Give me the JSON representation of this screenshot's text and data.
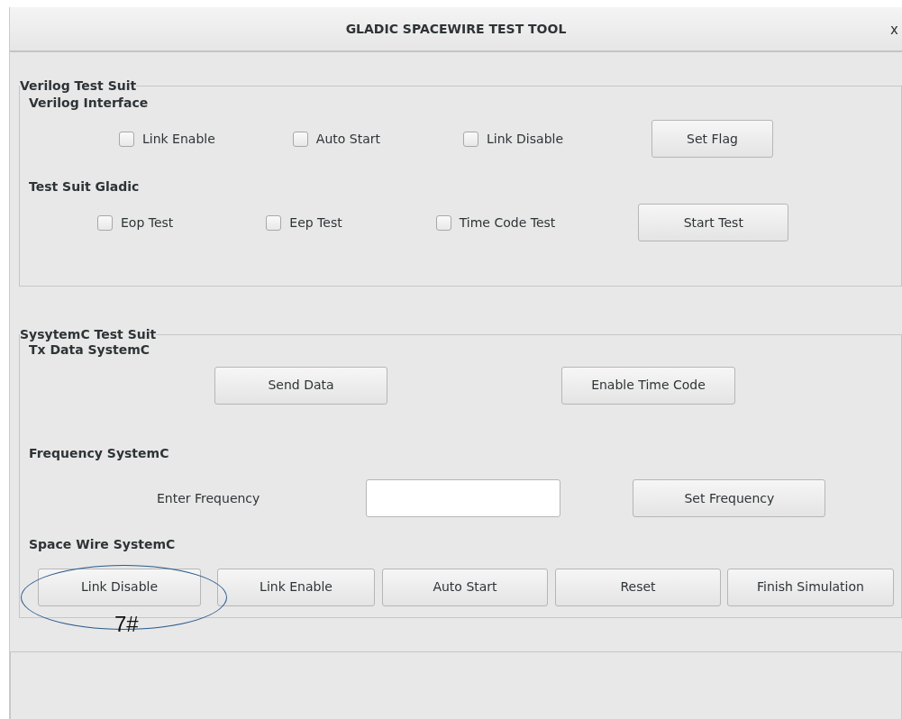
{
  "window": {
    "title": "GLADIC SPACEWIRE TEST TOOL",
    "close": "x"
  },
  "groups": [
    {
      "title": "Verilog Test Suit",
      "sections": [
        {
          "title": "Verilog Interface",
          "controls": [
            {
              "kind": "checkbox",
              "label": "Link Enable",
              "checked": false
            },
            {
              "kind": "checkbox",
              "label": "Auto Start",
              "checked": false
            },
            {
              "kind": "checkbox",
              "label": "Link Disable",
              "checked": false
            },
            {
              "kind": "button",
              "label": "Set Flag"
            }
          ]
        },
        {
          "title": "Test Suit Gladic",
          "controls": [
            {
              "kind": "checkbox",
              "label": "Eop Test",
              "checked": false
            },
            {
              "kind": "checkbox",
              "label": "Eep Test",
              "checked": false
            },
            {
              "kind": "checkbox",
              "label": "Time Code Test",
              "checked": false
            },
            {
              "kind": "button",
              "label": "Start Test"
            }
          ]
        }
      ]
    },
    {
      "title": "SysytemC Test Suit",
      "sections": [
        {
          "title": "Tx Data SystemC",
          "controls": [
            {
              "kind": "button",
              "label": "Send Data"
            },
            {
              "kind": "button",
              "label": "Enable Time Code"
            }
          ]
        },
        {
          "title": "Frequency  SystemC",
          "controls": [
            {
              "kind": "label",
              "label": "Enter Frequency"
            },
            {
              "kind": "field"
            },
            {
              "kind": "button",
              "label": "Set Frequency"
            }
          ]
        },
        {
          "title": "Space Wire SystemC",
          "controls": [
            {
              "kind": "button",
              "label": "Link Disable"
            },
            {
              "kind": "button",
              "label": "Link Enable"
            },
            {
              "kind": "button",
              "label": "Auto Start"
            },
            {
              "kind": "button",
              "label": "Reset"
            },
            {
              "kind": "button",
              "label": "Finish Simulation"
            }
          ]
        }
      ]
    }
  ],
  "annotation": {
    "label": "7#"
  }
}
